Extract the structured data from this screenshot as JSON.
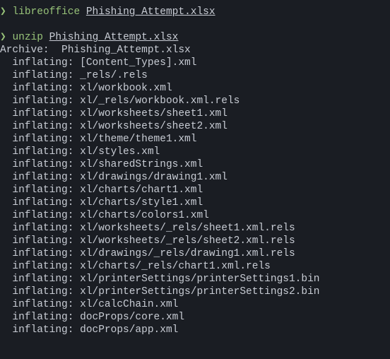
{
  "prompt": "❯",
  "commands": [
    {
      "cmd": "libreoffice",
      "arg": "Phishing_Attempt.xlsx"
    },
    {
      "cmd": "unzip",
      "arg": "Phishing_Attempt.xlsx"
    }
  ],
  "archive_line": "Archive:  Phishing_Attempt.xlsx",
  "inflate_label": "  inflating:",
  "inflated": [
    "[Content_Types].xml",
    "_rels/.rels",
    "xl/workbook.xml",
    "xl/_rels/workbook.xml.rels",
    "xl/worksheets/sheet1.xml",
    "xl/worksheets/sheet2.xml",
    "xl/theme/theme1.xml",
    "xl/styles.xml",
    "xl/sharedStrings.xml",
    "xl/drawings/drawing1.xml",
    "xl/charts/chart1.xml",
    "xl/charts/style1.xml",
    "xl/charts/colors1.xml",
    "xl/worksheets/_rels/sheet1.xml.rels",
    "xl/worksheets/_rels/sheet2.xml.rels",
    "xl/drawings/_rels/drawing1.xml.rels",
    "xl/charts/_rels/chart1.xml.rels",
    "xl/printerSettings/printerSettings1.bin",
    "xl/printerSettings/printerSettings2.bin",
    "xl/calcChain.xml",
    "docProps/core.xml",
    "docProps/app.xml"
  ]
}
